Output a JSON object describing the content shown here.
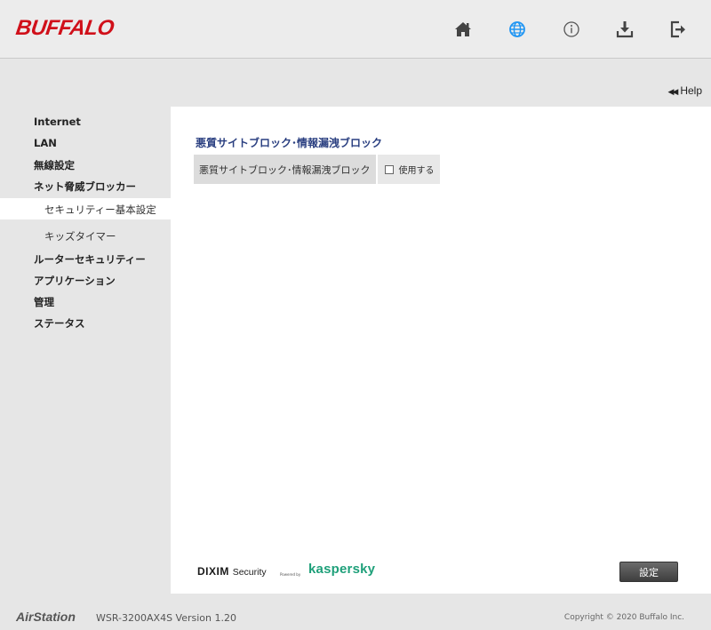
{
  "header": {
    "logo": "BUFFALO",
    "icons": [
      {
        "name": "home-icon"
      },
      {
        "name": "globe-icon"
      },
      {
        "name": "info-icon"
      },
      {
        "name": "download-icon"
      },
      {
        "name": "logout-icon"
      }
    ],
    "accent_color": "#2196f3"
  },
  "help": {
    "label": "Help"
  },
  "sidebar": {
    "items": [
      {
        "label": "Internet"
      },
      {
        "label": "LAN"
      },
      {
        "label": "無線設定"
      },
      {
        "label": "ネット脅威ブロッカー"
      },
      {
        "label": "セキュリティー基本設定",
        "active": true
      },
      {
        "label": "キッズタイマー"
      },
      {
        "label": "ルーターセキュリティー"
      },
      {
        "label": "アプリケーション"
      },
      {
        "label": "管理"
      },
      {
        "label": "ステータス"
      }
    ]
  },
  "main": {
    "title": "悪質サイトブロック･情報漏洩ブロック",
    "row": {
      "label": "悪質サイトブロック･情報漏洩ブロック",
      "checkbox_label": "使用する",
      "checked": false
    },
    "brand": {
      "dixim": "DIXIM",
      "security": "Security",
      "powered": "Powered by",
      "kaspersky": "kaspersky"
    },
    "save_label": "設定"
  },
  "footer": {
    "brand": "AirStation",
    "model": "WSR-3200AX4S  Version 1.20",
    "copyright": "Copyright © 2020 Buffalo Inc."
  }
}
